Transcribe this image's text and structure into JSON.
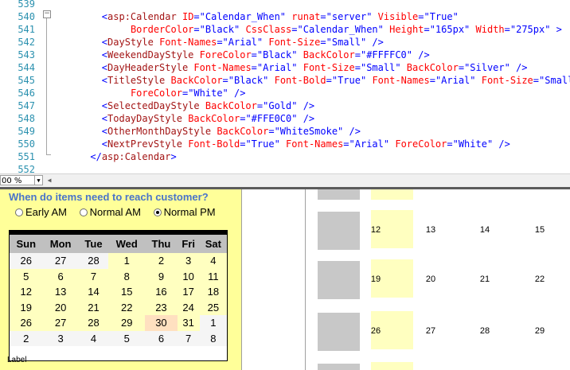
{
  "editor": {
    "lines": [
      {
        "num": "539"
      },
      {
        "num": "540"
      },
      {
        "num": "541"
      },
      {
        "num": "542"
      },
      {
        "num": "543"
      },
      {
        "num": "544"
      },
      {
        "num": "545"
      },
      {
        "num": "546"
      },
      {
        "num": "547"
      },
      {
        "num": "548"
      },
      {
        "num": "549"
      },
      {
        "num": "550"
      },
      {
        "num": "551"
      },
      {
        "num": "552"
      }
    ],
    "code": {
      "l540": {
        "tag": "asp:Calendar",
        "attrs": [
          [
            "ID",
            "\"Calendar_When\""
          ],
          [
            "runat",
            "\"server\""
          ],
          [
            "Visible",
            "\"True\""
          ]
        ]
      },
      "l541": {
        "attrs": [
          [
            "BorderColor",
            "\"Black\""
          ],
          [
            "CssClass",
            "\"Calendar_When\""
          ],
          [
            "Height",
            "\"165px\""
          ],
          [
            "Width",
            "\"275px\""
          ]
        ],
        "close": ">"
      },
      "l542": {
        "tag": "DayStyle",
        "attrs": [
          [
            "Font-Names",
            "\"Arial\""
          ],
          [
            "Font-Size",
            "\"Small\""
          ]
        ],
        "close": "/>"
      },
      "l543": {
        "tag": "WeekendDayStyle",
        "attrs": [
          [
            "ForeColor",
            "\"Black\""
          ],
          [
            "BackColor",
            "\"#FFFFC0\""
          ]
        ],
        "close": "/>"
      },
      "l544": {
        "tag": "DayHeaderStyle",
        "attrs": [
          [
            "Font-Names",
            "\"Arial\""
          ],
          [
            "Font-Size",
            "\"Small\""
          ],
          [
            "BackColor",
            "\"Silver\""
          ]
        ],
        "close": "/>"
      },
      "l545": {
        "tag": "TitleStyle",
        "attrs": [
          [
            "BackColor",
            "\"Black\""
          ],
          [
            "Font-Bold",
            "\"True\""
          ],
          [
            "Font-Names",
            "\"Arial\""
          ],
          [
            "Font-Size",
            "\"Small\""
          ]
        ]
      },
      "l546": {
        "attrs": [
          [
            "ForeColor",
            "\"White\""
          ]
        ],
        "close": "/>"
      },
      "l547": {
        "tag": "SelectedDayStyle",
        "attrs": [
          [
            "BackColor",
            "\"Gold\""
          ]
        ],
        "close": "/>"
      },
      "l548": {
        "tag": "TodayDayStyle",
        "attrs": [
          [
            "BackColor",
            "\"#FFE0C0\""
          ]
        ],
        "close": "/>"
      },
      "l549": {
        "tag": "OtherMonthDayStyle",
        "attrs": [
          [
            "BackColor",
            "\"WhiteSmoke\""
          ]
        ],
        "close": "/>"
      },
      "l550": {
        "tag": "NextPrevStyle",
        "attrs": [
          [
            "Font-Bold",
            "\"True\""
          ],
          [
            "Font-Names",
            "\"Arial\""
          ],
          [
            "ForeColor",
            "\"White\""
          ]
        ],
        "close": "/>"
      },
      "l551": {
        "closeTag": "asp:Calendar"
      }
    },
    "zoom": "00 %"
  },
  "design": {
    "question": "When do items need to reach customer?",
    "options": [
      {
        "label": "Early AM",
        "selected": false
      },
      {
        "label": "Normal AM",
        "selected": false
      },
      {
        "label": "Normal PM",
        "selected": true
      }
    ],
    "calendar": {
      "headers": [
        "Sun",
        "Mon",
        "Tue",
        "Wed",
        "Thu",
        "Fri",
        "Sat"
      ],
      "weeks": [
        [
          {
            "d": "26",
            "k": "other"
          },
          {
            "d": "27",
            "k": "other"
          },
          {
            "d": "28",
            "k": "other"
          },
          {
            "d": "1",
            "k": "day"
          },
          {
            "d": "2",
            "k": "day"
          },
          {
            "d": "3",
            "k": "day"
          },
          {
            "d": "4",
            "k": "day"
          }
        ],
        [
          {
            "d": "5",
            "k": "day"
          },
          {
            "d": "6",
            "k": "day"
          },
          {
            "d": "7",
            "k": "day"
          },
          {
            "d": "8",
            "k": "day"
          },
          {
            "d": "9",
            "k": "day"
          },
          {
            "d": "10",
            "k": "day"
          },
          {
            "d": "11",
            "k": "day"
          }
        ],
        [
          {
            "d": "12",
            "k": "day"
          },
          {
            "d": "13",
            "k": "day"
          },
          {
            "d": "14",
            "k": "day"
          },
          {
            "d": "15",
            "k": "day"
          },
          {
            "d": "16",
            "k": "day"
          },
          {
            "d": "17",
            "k": "day"
          },
          {
            "d": "18",
            "k": "day"
          }
        ],
        [
          {
            "d": "19",
            "k": "day"
          },
          {
            "d": "20",
            "k": "day"
          },
          {
            "d": "21",
            "k": "day"
          },
          {
            "d": "22",
            "k": "day"
          },
          {
            "d": "23",
            "k": "day"
          },
          {
            "d": "24",
            "k": "day"
          },
          {
            "d": "25",
            "k": "day"
          }
        ],
        [
          {
            "d": "26",
            "k": "day"
          },
          {
            "d": "27",
            "k": "day"
          },
          {
            "d": "28",
            "k": "day"
          },
          {
            "d": "29",
            "k": "day"
          },
          {
            "d": "30",
            "k": "today"
          },
          {
            "d": "31",
            "k": "day"
          },
          {
            "d": "1",
            "k": "other"
          }
        ],
        [
          {
            "d": "2",
            "k": "other"
          },
          {
            "d": "3",
            "k": "other"
          },
          {
            "d": "4",
            "k": "other"
          },
          {
            "d": "5",
            "k": "other"
          },
          {
            "d": "6",
            "k": "other"
          },
          {
            "d": "7",
            "k": "other"
          },
          {
            "d": "8",
            "k": "other"
          }
        ]
      ]
    },
    "label": "Label",
    "right_calendar": {
      "rows": [
        {
          "nums": [
            "12",
            "13",
            "14",
            "15"
          ]
        },
        {
          "nums": [
            "19",
            "20",
            "21",
            "22"
          ]
        },
        {
          "nums": [
            "26",
            "27",
            "28",
            "29"
          ]
        }
      ]
    },
    "colors": {
      "panel_bg": "#FFFF99",
      "question": "#4A74C9",
      "day_bg": "#FFFFC0",
      "today_bg": "#FFE0C0",
      "other_bg": "#F5F5F5",
      "header_bg": "#C0C0C0"
    }
  }
}
